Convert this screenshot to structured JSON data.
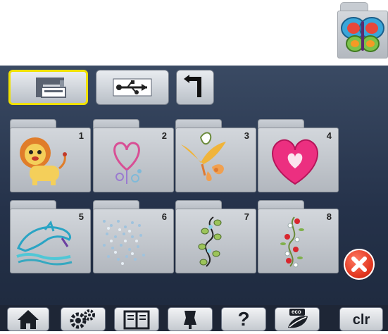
{
  "top_preview": {
    "icon": "butterfly-icon"
  },
  "toolbar": {
    "items": [
      {
        "icon": "embroidery-machine-icon",
        "selected": true
      },
      {
        "icon": "usb-icon",
        "selected": false
      },
      {
        "icon": "back-arrow-icon",
        "selected": false
      }
    ]
  },
  "design_folders": [
    {
      "number": "1",
      "icon": "lion-design-icon"
    },
    {
      "number": "2",
      "icon": "heart-outline-design-icon"
    },
    {
      "number": "3",
      "icon": "flower-design-icon"
    },
    {
      "number": "4",
      "icon": "lace-heart-design-icon"
    },
    {
      "number": "5",
      "icon": "dolphin-design-icon"
    },
    {
      "number": "6",
      "icon": "dotted-pattern-design-icon"
    },
    {
      "number": "7",
      "icon": "vine-border-design-icon"
    },
    {
      "number": "8",
      "icon": "floral-border-design-icon"
    }
  ],
  "close_button": {
    "icon": "close-icon"
  },
  "bottom_bar": {
    "help_label": "?",
    "eco_label": "eco",
    "clr_label": "clr"
  }
}
